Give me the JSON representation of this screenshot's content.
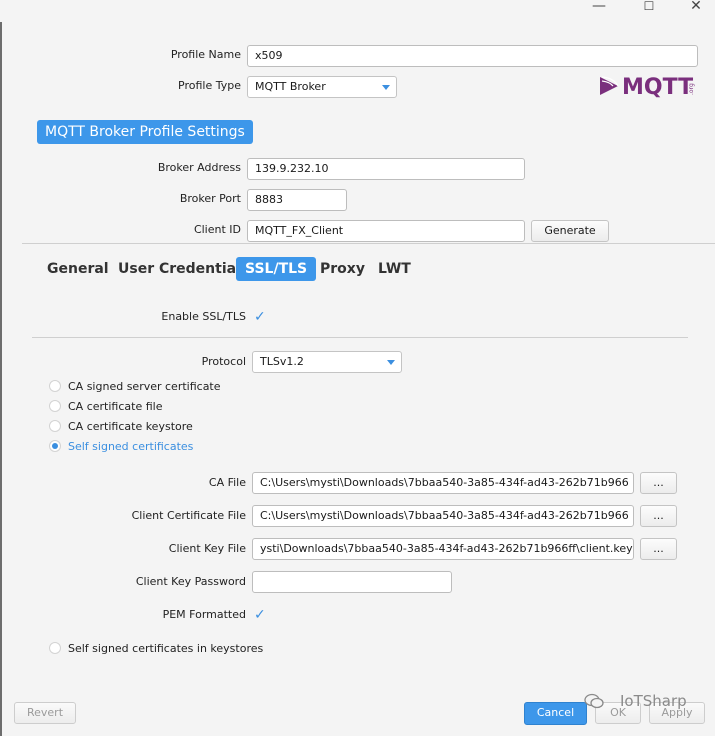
{
  "window": {
    "minimize_glyph": "—",
    "maximize_glyph": "☐",
    "close_glyph": "✕"
  },
  "profile": {
    "name_label": "Profile Name",
    "name_value": "x509",
    "type_label": "Profile Type",
    "type_value": "MQTT Broker"
  },
  "logo": {
    "text": "MQTT",
    "suffix": ".org"
  },
  "broker": {
    "section_title": "MQTT Broker Profile Settings",
    "address_label": "Broker Address",
    "address_value": "139.9.232.10",
    "port_label": "Broker Port",
    "port_value": "8883",
    "client_id_label": "Client ID",
    "client_id_value": "MQTT_FX_Client",
    "generate_label": "Generate"
  },
  "tabs": [
    {
      "label": "General"
    },
    {
      "label": "User Credentials"
    },
    {
      "label": "SSL/TLS"
    },
    {
      "label": "Proxy"
    },
    {
      "label": "LWT"
    }
  ],
  "ssl": {
    "enable_label": "Enable SSL/TLS",
    "check_glyph": "✓",
    "protocol_label": "Protocol",
    "protocol_value": "TLSv1.2",
    "radios": [
      {
        "label": "CA signed server certificate"
      },
      {
        "label": "CA certificate file"
      },
      {
        "label": "CA certificate keystore"
      },
      {
        "label": "Self signed certificates"
      }
    ],
    "ca_file_label": "CA File",
    "ca_file_value": "C:\\Users\\mysti\\Downloads\\7bbaa540-3a85-434f-ad43-262b71b966",
    "client_cert_label": "Client Certificate File",
    "client_cert_value": "C:\\Users\\mysti\\Downloads\\7bbaa540-3a85-434f-ad43-262b71b966",
    "client_key_label": "Client Key File",
    "client_key_value": "ysti\\Downloads\\7bbaa540-3a85-434f-ad43-262b71b966ff\\client.key",
    "browse_label": "...",
    "key_password_label": "Client Key Password",
    "key_password_value": "",
    "pem_label": "PEM Formatted",
    "keystores_label": "Self signed certificates in keystores"
  },
  "footer": {
    "revert_label": "Revert",
    "cancel_label": "Cancel",
    "ok_label": "OK",
    "apply_label": "Apply",
    "watermark": "IoTSharp"
  },
  "colors": {
    "accent": "#3d97ea",
    "check": "#3b8fe0",
    "logo_purple": "#7a2f7d"
  }
}
